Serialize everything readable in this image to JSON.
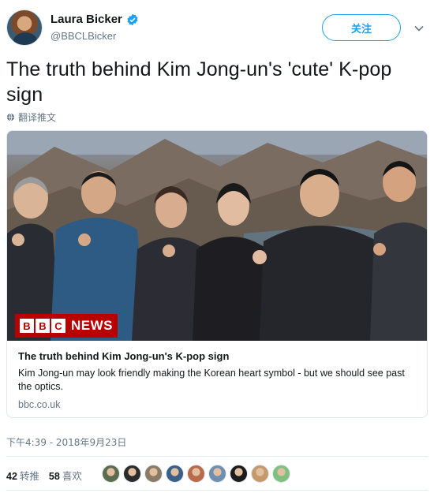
{
  "user": {
    "display_name": "Laura Bicker",
    "handle": "@BBCLBicker",
    "verified_icon": "verified-badge-icon",
    "follow_label": "关注"
  },
  "tweet": {
    "text": "The truth behind Kim Jong-un's 'cute' K-pop sign",
    "translate_label": "翻译推文",
    "timestamp": "下午4:39 - 2018年9月23日"
  },
  "card": {
    "logo_letters": [
      "B",
      "B",
      "C"
    ],
    "logo_news": "NEWS",
    "title": "The truth behind Kim Jong-un's K-pop sign",
    "description": "Kim Jong-un may look friendly making the Korean heart symbol - but we should see past the optics.",
    "domain": "bbc.co.uk"
  },
  "stats": {
    "retweets_count": "42",
    "retweets_label": "转推",
    "likes_count": "58",
    "likes_label": "喜欢"
  },
  "likers": [
    {
      "name": "liker-avatar-1",
      "color": "#5d6b4e"
    },
    {
      "name": "liker-avatar-2",
      "color": "#2b2b2b"
    },
    {
      "name": "liker-avatar-3",
      "color": "#8a7a66"
    },
    {
      "name": "liker-avatar-4",
      "color": "#3c5f87"
    },
    {
      "name": "liker-avatar-5",
      "color": "#b86a4a"
    },
    {
      "name": "liker-avatar-6",
      "color": "#6f8fb0"
    },
    {
      "name": "liker-avatar-7",
      "color": "#1c1c1c"
    },
    {
      "name": "liker-avatar-8",
      "color": "#c49a6c"
    },
    {
      "name": "liker-avatar-9",
      "color": "#7fbf7f"
    }
  ],
  "colors": {
    "accent": "#1da1f2",
    "secondary_text": "#657786",
    "bbc_red": "#b80000"
  }
}
